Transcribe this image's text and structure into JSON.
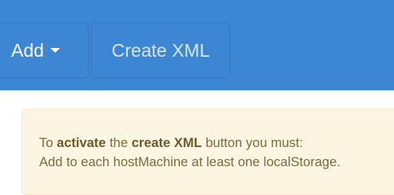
{
  "navbar": {
    "add_label": "Add",
    "create_xml_label": "Create XML"
  },
  "alert": {
    "line1": {
      "t1": "To ",
      "b1": "activate",
      "t2": " the ",
      "b2": "create XML",
      "t3": " button you must:"
    },
    "line2": "Add to each hostMachine at least one localStorage."
  },
  "colors": {
    "navbar_bg": "#3d86d4",
    "alert_bg": "#fcf5e2",
    "alert_text": "#7e6a3c"
  },
  "icons": {
    "add_dropdown": "caret-down-icon"
  }
}
